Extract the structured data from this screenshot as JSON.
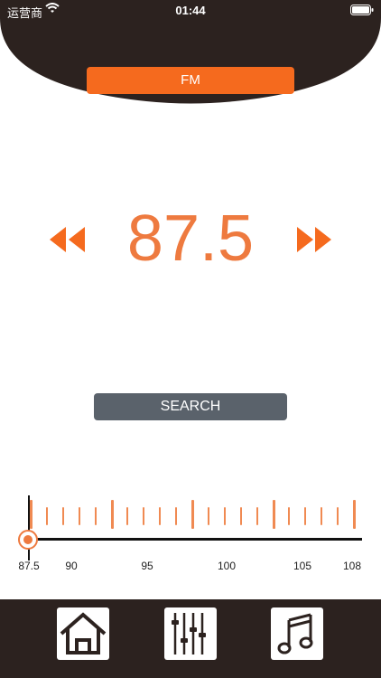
{
  "status_bar": {
    "carrier": "运营商",
    "time": "01:44"
  },
  "band": {
    "label": "FM"
  },
  "frequency": {
    "value": "87.5"
  },
  "search": {
    "label": "SEARCH"
  },
  "tuner": {
    "current": 87.5,
    "min": 87.5,
    "max": 108,
    "scale_labels": [
      "87.5",
      "90",
      "95",
      "100",
      "105",
      "108"
    ]
  },
  "colors": {
    "accent": "#f56a1e",
    "header": "#2c221f",
    "search": "#5a626b"
  },
  "tabs": [
    {
      "icon": "home-icon"
    },
    {
      "icon": "equalizer-icon"
    },
    {
      "icon": "music-note-icon"
    }
  ]
}
